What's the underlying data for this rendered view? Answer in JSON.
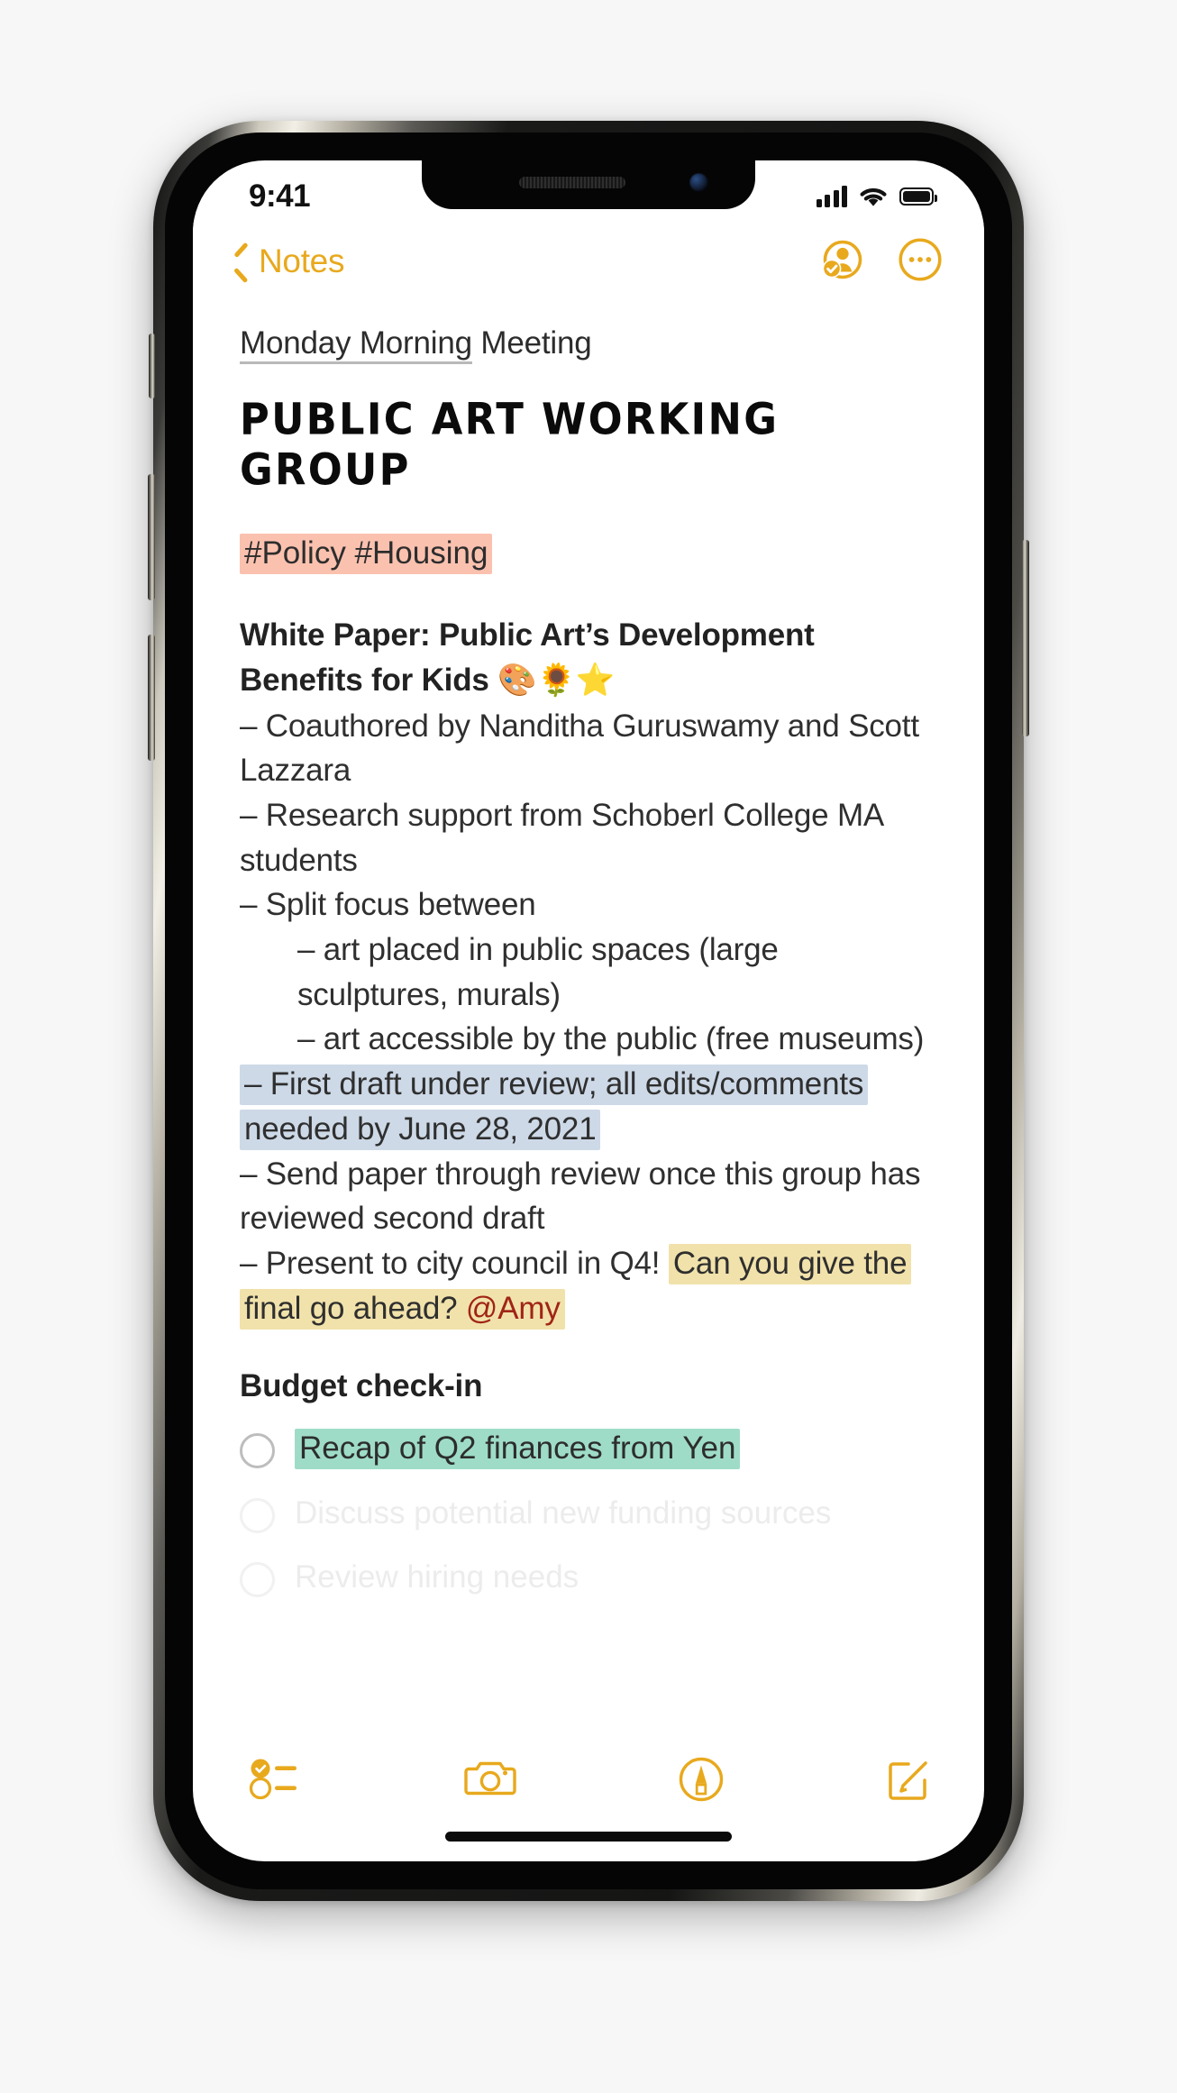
{
  "accent_color": "#E8A91D",
  "status_bar": {
    "time": "9:41",
    "cellular_icon": "signal-bars-icon",
    "wifi_icon": "wifi-icon",
    "battery_icon": "battery-full-icon"
  },
  "nav_bar": {
    "back_label": "Notes",
    "back_icon": "chevron-left-icon",
    "collaborate_icon": "person-checkmark-icon",
    "more_icon": "more-circle-icon"
  },
  "note": {
    "title_underlined": "Monday Morning",
    "title_plain": " Meeting",
    "marker_heading": "PUBLIC ART WORKING GROUP",
    "tags": "#Policy #Housing",
    "tags_highlight": "#FBC1AF",
    "white_paper_heading": "White Paper: Public Art’s Development Benefits for Kids",
    "white_paper_emoji": "🎨🌻⭐",
    "bullets": [
      {
        "text": "– Coauthored by Nanditha Guruswamy and Scott Lazzara",
        "indent": false,
        "highlight": null
      },
      {
        "text": "– Research support from Schoberl College MA students",
        "indent": false,
        "highlight": null
      },
      {
        "text": "– Split focus between",
        "indent": false,
        "highlight": null
      },
      {
        "text": "– art placed in public spaces (large sculptures, murals)",
        "indent": true,
        "highlight": null
      },
      {
        "text": "– art accessible by the public (free museums)",
        "indent": true,
        "highlight": null
      },
      {
        "text": "– First draft under review; all edits/comments needed by June 28, 2021",
        "indent": false,
        "highlight": "#CDD9E7"
      },
      {
        "text": "– Send paper through review once this group has reviewed second draft",
        "indent": false,
        "highlight": null
      }
    ],
    "present_line_plain": "– Present to city council in Q4! ",
    "present_line_highlighted": "Can you give the final go ahead? ",
    "mention": "@Amy",
    "mention_color": "#A02516",
    "present_highlight": "#F1E2AB",
    "budget_heading": "Budget check-in",
    "todos": [
      {
        "text": "Recap of Q2 finances from Yen",
        "highlight": "#9EDCC8",
        "checked": false,
        "faded": false
      },
      {
        "text": "Discuss potential new funding sources",
        "highlight": null,
        "checked": false,
        "faded": true
      },
      {
        "text": "Review hiring needs",
        "highlight": null,
        "checked": false,
        "faded": true
      }
    ]
  },
  "toolbar": {
    "checklist_icon": "checklist-icon",
    "camera_icon": "camera-icon",
    "markup_icon": "markup-pen-icon",
    "compose_icon": "compose-icon"
  }
}
